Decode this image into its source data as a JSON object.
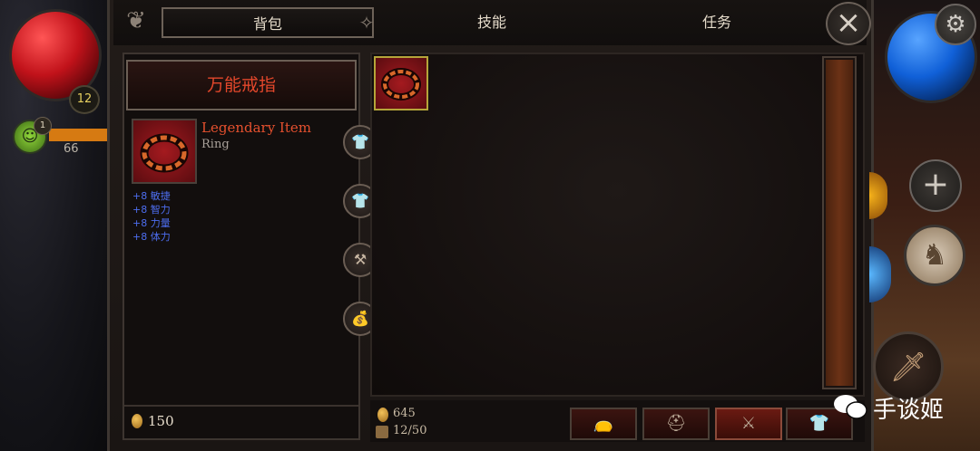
{
  "tabs": [
    {
      "label": "背包",
      "active": true
    },
    {
      "label": "技能",
      "active": false
    },
    {
      "label": "任务",
      "active": false
    }
  ],
  "hud": {
    "player_level": "12",
    "pet_level": "1",
    "pet_xp_value": "66",
    "close_icon": "×",
    "settings_icon": "gear-icon"
  },
  "item": {
    "title": "万能戒指",
    "name": "Legendary Item",
    "type": "Ring",
    "stats": [
      "+8 敏捷",
      "+8 智力",
      "+8 力量",
      "+8 体力"
    ],
    "rarity_color": "#e5502e",
    "stat_color": "#4d6ef0"
  },
  "side_buttons": [
    "equip-icon",
    "compare-icon",
    "anvil-icon",
    "sell-bag-icon"
  ],
  "currency": {
    "gold_left": "150",
    "gold_bottom": "645",
    "capacity": "12/50"
  },
  "bottom_actions": [
    "bag-icon",
    "helmet-icon",
    "crossed-swords-icon",
    "armor-icon"
  ],
  "watermark": "手谈姬"
}
